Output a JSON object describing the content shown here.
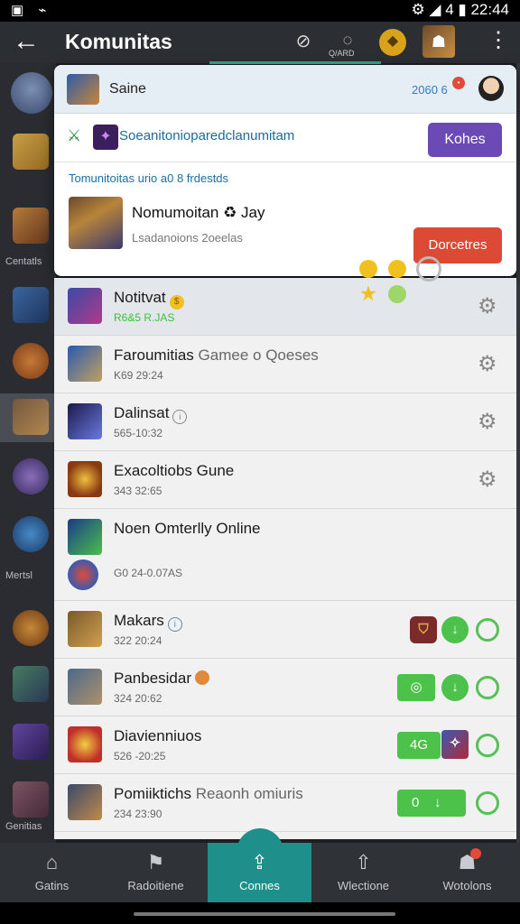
{
  "status_bar": {
    "left_icons": "▣ ⌁",
    "right": "⚙ ◢ 4 ▮ 22:44"
  },
  "app_bar": {
    "back": "←",
    "title": "Komunitas",
    "icon2_label": "Q/ARD"
  },
  "popup": {
    "header_name": "Saine",
    "header_count": "2060 6",
    "row2_text": "Soeanitonioparedclanumitam",
    "row2_button": "Kohes",
    "section_title": "Tomunitoitas urio a0 8 frdestds",
    "game_title": "Nomumoitan ♻ Jay",
    "game_subtitle": "Lsadanoions 2oeelas",
    "game_button": "Dorcetres"
  },
  "list": [
    {
      "title": "Notitvat",
      "sub": "R6&5 R.JAS",
      "ctrl": "gear"
    },
    {
      "title": "Faroumitias",
      "title_extra": "Gamee o Qoeses",
      "sub": "K69 29:24",
      "ctrl": "gear"
    },
    {
      "title": "Dalinsat",
      "sub": "565-10:32",
      "ctrl": "gear"
    },
    {
      "title": "Exacoltiobs",
      "title_extra": "Gune",
      "sub": "343 32:65",
      "ctrl": "gear"
    },
    {
      "title": "Noen Omterlly Online",
      "sub": "G0 24-0.07AS",
      "ctrl": "dots"
    },
    {
      "title": "Makars",
      "sub": "322 20:24",
      "ctrl": "shield"
    },
    {
      "title": "Panbesidar",
      "sub": "324 20:62",
      "ctrl": "ring"
    },
    {
      "title": "Diavienniuos",
      "sub": "526 -20:25",
      "ctrl": "box"
    },
    {
      "title": "Pomiiktichs",
      "title_extra": "Reaonh omiuris",
      "sub": "234 23:90",
      "ctrl": "green"
    }
  ],
  "controls": {
    "box_label": "4G",
    "green_label": "0"
  },
  "side_labels": [
    "Centatls",
    "Mertsl",
    "Genitias"
  ],
  "bottom_nav": [
    {
      "icon": "⌂",
      "label": "Gatins"
    },
    {
      "icon": "⚑",
      "label": "Radoitiene"
    },
    {
      "icon": "⇪",
      "label": "Connes"
    },
    {
      "icon": "⇧",
      "label": "Wlectione"
    },
    {
      "icon": "☗",
      "label": "Wotolons"
    }
  ]
}
